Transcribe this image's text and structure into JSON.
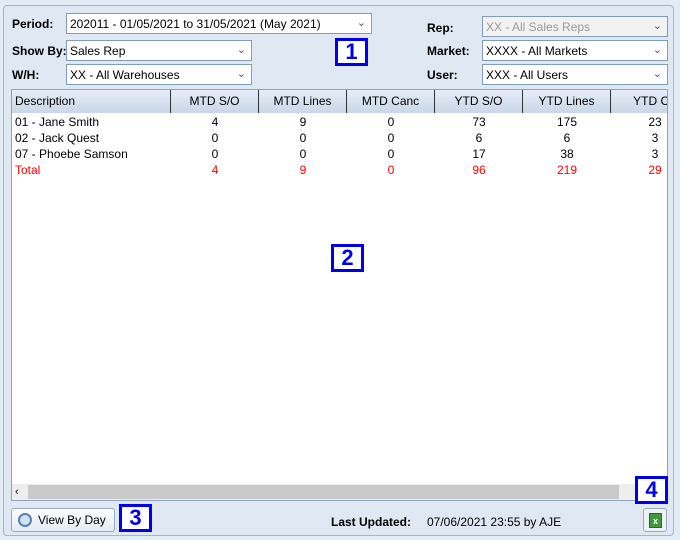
{
  "filters": {
    "period": {
      "label": "Period:",
      "value": "202011 - 01/05/2021 to 31/05/2021 (May 2021)"
    },
    "show_by": {
      "label": "Show By:",
      "value": "Sales Rep"
    },
    "wh": {
      "label": "W/H:",
      "value": "XX - All Warehouses"
    },
    "rep": {
      "label": "Rep:",
      "value": "XX - All Sales Reps",
      "disabled": true
    },
    "market": {
      "label": "Market:",
      "value": "XXXX - All Markets"
    },
    "user": {
      "label": "User:",
      "value": "XXX - All Users"
    }
  },
  "table": {
    "columns": [
      "Description",
      "MTD S/O",
      "MTD Lines",
      "MTD Canc",
      "YTD S/O",
      "YTD Lines",
      "YTD Ca"
    ],
    "rows": [
      [
        "01 - Jane Smith",
        "4",
        "9",
        "0",
        "73",
        "175",
        "23"
      ],
      [
        "02 - Jack Quest",
        "0",
        "0",
        "0",
        "6",
        "6",
        "3"
      ],
      [
        "07 - Phoebe Samson",
        "0",
        "0",
        "0",
        "17",
        "38",
        "3"
      ]
    ],
    "total": [
      "Total",
      "4",
      "9",
      "0",
      "96",
      "219",
      "29"
    ],
    "total_color": "#ff0000"
  },
  "footer": {
    "view_by_day": "View By Day",
    "last_updated_label": "Last Updated:",
    "last_updated_value": "07/06/2021 23:55 by AJE",
    "export_icon": "excel-icon"
  },
  "annotations": [
    "1",
    "2",
    "3",
    "4"
  ]
}
